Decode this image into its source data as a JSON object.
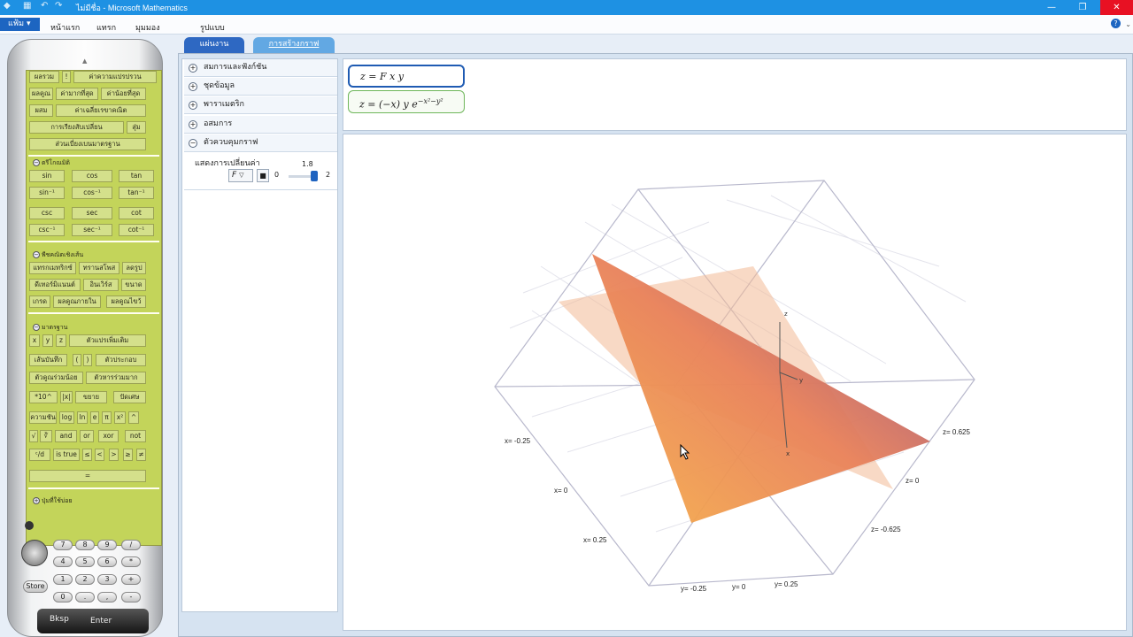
{
  "window": {
    "title": "ไม่มีชื่อ - Microsoft Mathematics",
    "quick_access": [
      "▦",
      "↶",
      "↷"
    ],
    "buttons": {
      "minimize": "—",
      "maximize": "❐",
      "close": "✕"
    },
    "accent_color": "#1e91e3"
  },
  "menu": {
    "file": "แฟ้ม",
    "items": [
      "หน้าแรก",
      "แทรก",
      "มุมมอง",
      "รูปแบบ"
    ],
    "help": "?",
    "collapse": "⌄"
  },
  "tabs": [
    {
      "label": "แผ่นงาน",
      "active": true
    },
    {
      "label": "การสร้างกราฟ",
      "active": false
    }
  ],
  "calculator": {
    "top_rows": [
      [
        "ผลรวม",
        "!",
        "ค่าความแปรปรวน"
      ],
      [
        "ผลคูณ",
        "ค่ามากที่สุด",
        "ค่าน้อยที่สุด"
      ],
      [
        "ผสม",
        "ค่าเฉลี่ยเรขาคณิต"
      ],
      [
        "การเรียงสับเปลี่ยน",
        "สุ่ม"
      ],
      [
        "ส่วนเบี่ยงเบนมาตรฐาน"
      ]
    ],
    "trig_header": "ตรีโกณมิติ",
    "trig_rows": [
      [
        "sin",
        "cos",
        "tan"
      ],
      [
        "sin⁻¹",
        "cos⁻¹",
        "tan⁻¹"
      ],
      [
        "csc",
        "sec",
        "cot"
      ],
      [
        "csc⁻¹",
        "sec⁻¹",
        "cot⁻¹"
      ]
    ],
    "linear_header": "พีชคณิตเชิงเส้น",
    "linear_rows": [
      [
        "แทรกเมทริกซ์",
        "ทรานสโพส",
        "ลดรูป"
      ],
      [
        "ดีเทอร์มิแนนต์",
        "อินเวิร์ส",
        "ขนาด"
      ],
      [
        "เกรด",
        "ผลคูณภายใน",
        "ผลคูณไขว้"
      ]
    ],
    "standard_header": "มาตรฐาน",
    "standard_rows": [
      [
        "x",
        "y",
        "z",
        "ตัวแปรเพิ่มเติม"
      ],
      [
        "เส้นบันทึก",
        "(",
        ")",
        "ตัวประกอบ"
      ],
      [
        "ตัวคูณร่วมน้อย",
        "ตัวหารร่วมมาก"
      ],
      [
        "*10^",
        "|x|",
        "ขยาย",
        "ปัดเศษ"
      ],
      [
        "ความชัน",
        "log",
        "ln",
        "e",
        "π",
        "x²",
        "^"
      ],
      [
        "√",
        "∛",
        "and",
        "or",
        "xor",
        "not"
      ],
      [
        "ᶜ/d",
        "is true",
        "≤",
        "<",
        ">",
        "≥",
        "≠"
      ],
      [
        "="
      ]
    ],
    "favorites_header": "ปุ่มที่ใช้บ่อย",
    "keypad": {
      "rows": [
        [
          "7",
          "8",
          "9",
          "/"
        ],
        [
          "4",
          "5",
          "6",
          "*"
        ],
        [
          "1",
          "2",
          "3",
          "+"
        ],
        [
          "0",
          ".",
          ",",
          "-"
        ]
      ],
      "store": "Store",
      "backspace": "Bksp",
      "enter": "Enter"
    }
  },
  "left_panel": {
    "sections": [
      "สมการและฟังก์ชัน",
      "ชุดข้อมูล",
      "พาราเมตริก",
      "อสมการ",
      "ตัวควบคุมกราฟ"
    ],
    "animate_label": "แสดงการเปลี่ยนค่า",
    "variable": "F",
    "slider": {
      "min": "0",
      "max": "2",
      "value": "1.8"
    }
  },
  "equations": [
    {
      "text": "z = F x y",
      "color": "#1f5bb3"
    },
    {
      "text": "z = (−x) y e^(−x²−y²)",
      "display_base": "z = (−x) y e",
      "display_sup": "−x²−y²",
      "color": "#6eb65a"
    }
  ],
  "plot": {
    "axis_names": [
      "x",
      "y",
      "z"
    ],
    "x_ticks": [
      "x= -0.25",
      "x= 0",
      "x= 0.25"
    ],
    "y_ticks": [
      "y= -0.25",
      "y= 0",
      "y= 0.25"
    ],
    "z_ticks": [
      "z= -0.625",
      "z= 0",
      "z= 0.625"
    ],
    "surface_colors": [
      "#f3a64f",
      "#9b4e7e"
    ]
  }
}
